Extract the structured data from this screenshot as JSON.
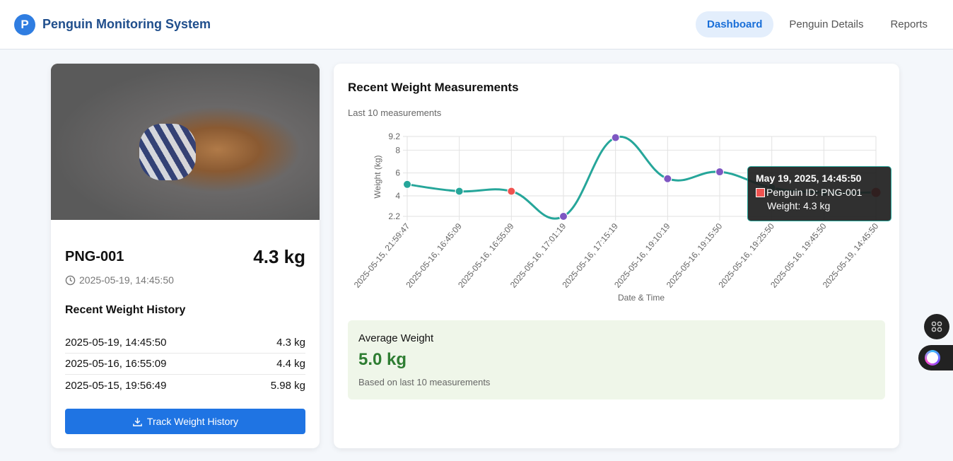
{
  "nav": {
    "logo_letter": "P",
    "title": "Penguin Monitoring System",
    "tabs": [
      {
        "label": "Dashboard",
        "active": true
      },
      {
        "label": "Penguin Details"
      },
      {
        "label": "Reports"
      }
    ]
  },
  "penguin": {
    "id": "PNG-001",
    "weight": "4.3 kg",
    "timestamp": "2025-05-19, 14:45:50",
    "history_title": "Recent Weight History",
    "history": [
      {
        "date": "2025-05-19, 14:45:50",
        "weight": "4.3 kg"
      },
      {
        "date": "2025-05-16, 16:55:09",
        "weight": "4.4 kg"
      },
      {
        "date": "2025-05-15, 19:56:49",
        "weight": "5.98 kg"
      }
    ],
    "track_button": "Track Weight History"
  },
  "chart_card": {
    "title": "Recent Weight Measurements",
    "subtitle": "Last 10 measurements"
  },
  "chart_data": {
    "type": "line",
    "xlabel": "Date & Time",
    "ylabel": "Weight (kg)",
    "ylim": [
      2.2,
      9.2
    ],
    "yticks": [
      "9.2",
      "8",
      "6",
      "4",
      "2.2"
    ],
    "categories": [
      "2025-05-15, 21:59:47",
      "2025-05-16, 16:45:09",
      "2025-05-16, 16:55:09",
      "2025-05-16, 17:01:19",
      "2025-05-16, 17:15:19",
      "2025-05-16, 19:10:19",
      "2025-05-16, 19:15:50",
      "2025-05-16, 19:25:50",
      "2025-05-16, 19:45:50",
      "2025-05-19, 14:45:50"
    ],
    "values": [
      5.0,
      4.4,
      4.4,
      2.2,
      9.1,
      5.5,
      6.1,
      4.7,
      4.3,
      4.3
    ],
    "point_colors": [
      "#26a69a",
      "#26a69a",
      "#ef5350",
      "#7e57c2",
      "#7e57c2",
      "#7e57c2",
      "#7e57c2",
      "#26a69a",
      "#26a69a",
      "#ff2a2a"
    ],
    "line_color": "#26a69a",
    "grid": true
  },
  "tooltip": {
    "title": "May 19, 2025, 14:45:50",
    "line1": "Penguin ID: PNG-001",
    "line2": "Weight: 4.3 kg"
  },
  "average": {
    "label": "Average Weight",
    "value": "5.0 kg",
    "note": "Based on last 10 measurements"
  }
}
